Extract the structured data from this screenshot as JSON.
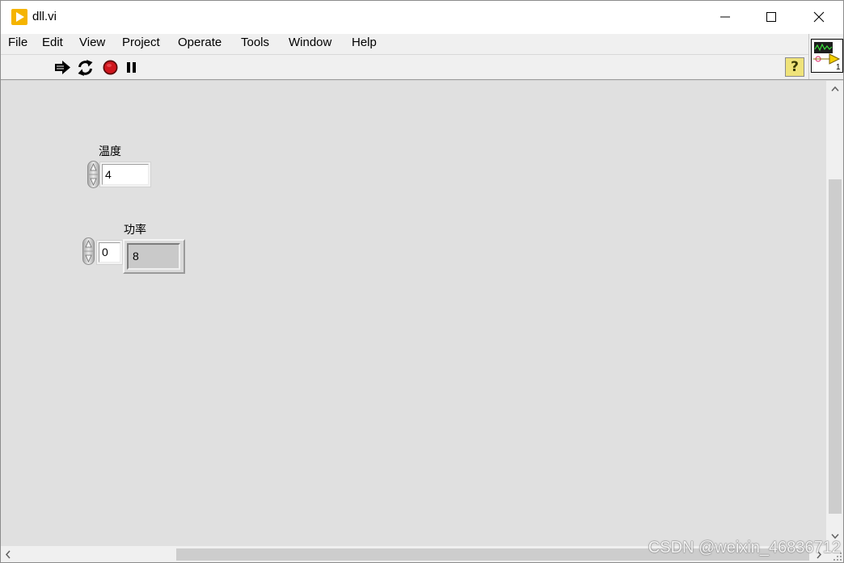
{
  "window": {
    "title": "dll.vi",
    "app_icon": "labview-vi-icon",
    "controls": {
      "minimize_icon": "minimize-icon",
      "maximize_icon": "maximize-icon",
      "close_icon": "close-icon"
    }
  },
  "menu": {
    "items": [
      {
        "label": "File"
      },
      {
        "label": "Edit"
      },
      {
        "label": "View"
      },
      {
        "label": "Project"
      },
      {
        "label": "Operate"
      },
      {
        "label": "Tools"
      },
      {
        "label": "Window"
      },
      {
        "label": "Help"
      }
    ]
  },
  "toolbar": {
    "buttons": [
      {
        "icon": "run-arrow-icon"
      },
      {
        "icon": "run-continuously-icon"
      },
      {
        "icon": "abort-execution-icon"
      },
      {
        "icon": "pause-icon"
      }
    ],
    "help": {
      "icon": "context-help-icon",
      "glyph": "?"
    }
  },
  "vi_icon": {
    "icon": "vi-connector-pane-icon",
    "number": "1"
  },
  "front_panel": {
    "controls": [
      {
        "label": "温度",
        "value": "4"
      },
      {
        "value": "0"
      },
      {
        "label": "功率",
        "value": "8"
      }
    ]
  },
  "scrollbars": {
    "vertical": {
      "up_icon": "chevron-up-icon",
      "down_icon": "chevron-down-icon"
    },
    "horizontal": {
      "left_icon": "chevron-left-icon",
      "right_icon": "chevron-right-icon"
    }
  },
  "watermark": "CSDN @weixin_46836712",
  "colors": {
    "panel_background": "#e0e0e0",
    "labview_icon": "#f5b400",
    "abort_red": "#d0161d",
    "help_yellow": "#efe37a"
  }
}
